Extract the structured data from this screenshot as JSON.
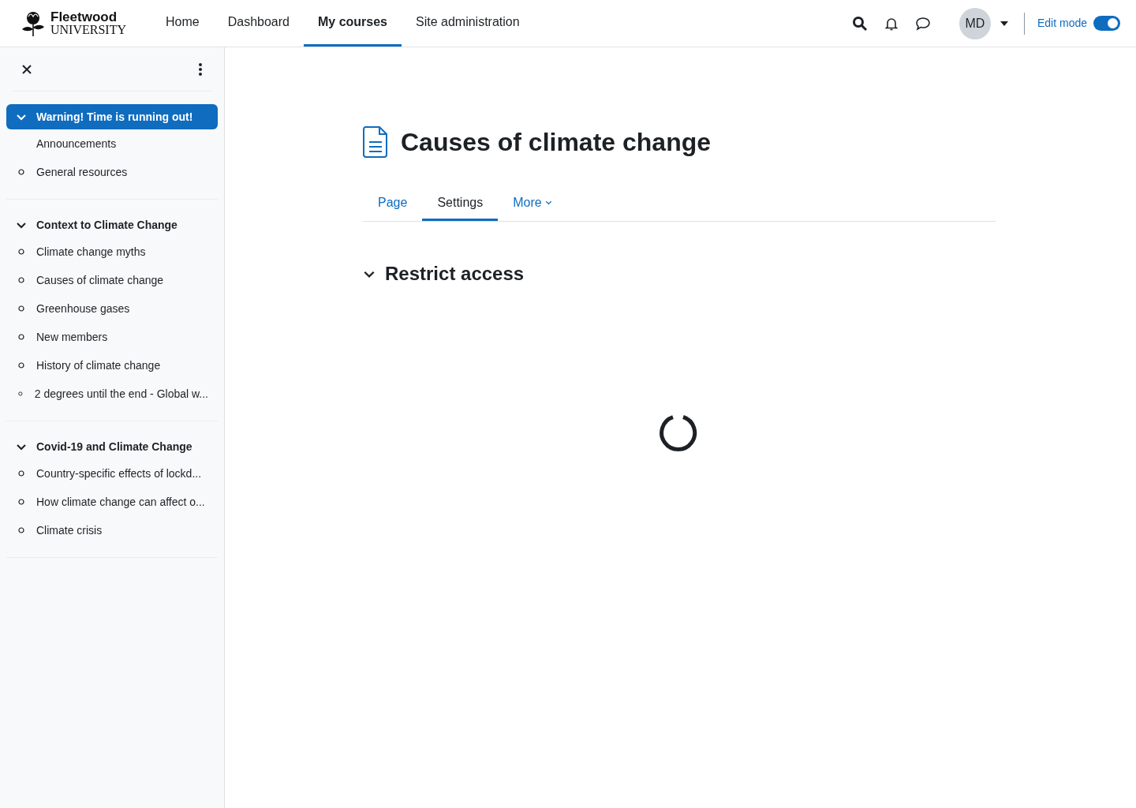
{
  "logo": {
    "name": "Fleetwood",
    "subtitle": "UNIVERSITY"
  },
  "nav": [
    {
      "label": "Home",
      "selected": false
    },
    {
      "label": "Dashboard",
      "selected": false
    },
    {
      "label": "My courses",
      "selected": true
    },
    {
      "label": "Site administration",
      "selected": false
    }
  ],
  "user": {
    "initials": "MD"
  },
  "edit_mode": {
    "label": "Edit mode",
    "on": true
  },
  "sidebar": {
    "sections": [
      {
        "title": "Warning! Time is running out!",
        "selected": true,
        "expanded": true,
        "items": [
          {
            "kind": "label",
            "label": "Announcements"
          },
          {
            "kind": "activity",
            "label": "General resources"
          }
        ]
      },
      {
        "title": "Context to Climate Change",
        "selected": false,
        "expanded": true,
        "items": [
          {
            "kind": "activity",
            "label": "Climate change myths"
          },
          {
            "kind": "activity",
            "label": "Causes of climate change"
          },
          {
            "kind": "activity",
            "label": "Greenhouse gases"
          },
          {
            "kind": "activity",
            "label": "New members"
          },
          {
            "kind": "activity",
            "label": "History of climate change"
          },
          {
            "kind": "activity",
            "label": "2 degrees until the end - Global w..."
          }
        ]
      },
      {
        "title": "Covid-19 and Climate Change",
        "selected": false,
        "expanded": true,
        "items": [
          {
            "kind": "activity",
            "label": "Country-specific effects of lockd..."
          },
          {
            "kind": "activity",
            "label": "How climate change can affect o..."
          },
          {
            "kind": "activity",
            "label": "Climate crisis"
          }
        ]
      }
    ]
  },
  "page": {
    "title": "Causes of climate change",
    "tabs": [
      {
        "label": "Page",
        "selected": false,
        "kind": "link"
      },
      {
        "label": "Settings",
        "selected": true,
        "kind": "link"
      },
      {
        "label": "More",
        "selected": false,
        "kind": "menu"
      }
    ],
    "section": {
      "title": "Restrict access",
      "expanded": true
    }
  }
}
